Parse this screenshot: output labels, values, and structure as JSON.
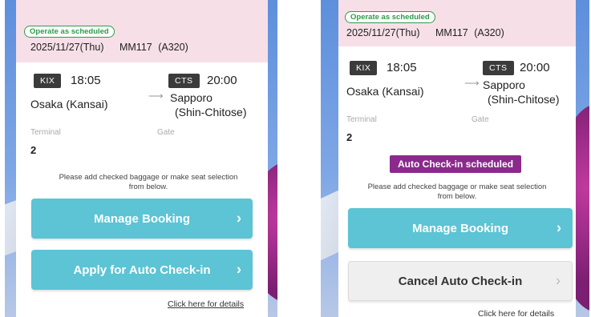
{
  "left": {
    "status": "Operate as scheduled",
    "date": "2025/11/27(Thu)",
    "flight": "MM117",
    "aircraft": "(A320)",
    "dep_code": "KIX",
    "dep_time": "18:05",
    "dep_city": "Osaka (Kansai)",
    "arr_code": "CTS",
    "arr_time": "20:00",
    "arr_city_1": "Sapporo",
    "arr_city_2": "(Shin-Chitose)",
    "terminal_label": "Terminal",
    "gate_label": "Gate",
    "terminal_value": "2",
    "note_1": "Please add checked baggage or make seat selection",
    "note_2": "from below.",
    "manage_label": "Manage Booking",
    "auto_checkin_label": "Apply for Auto Check-in",
    "details_link": "Click here for details"
  },
  "right": {
    "status": "Operate as scheduled",
    "date": "2025/11/27(Thu)",
    "flight": "MM117",
    "aircraft": "(A320)",
    "dep_code": "KIX",
    "dep_time": "18:05",
    "dep_city": "Osaka (Kansai)",
    "arr_code": "CTS",
    "arr_time": "20:00",
    "arr_city_1": "Sapporo",
    "arr_city_2": "(Shin-Chitose)",
    "terminal_label": "Terminal",
    "gate_label": "Gate",
    "terminal_value": "2",
    "auto_checkin_badge": "Auto Check-in scheduled",
    "note_1": "Please add checked baggage or make seat selection",
    "note_2": "from below.",
    "manage_label": "Manage Booking",
    "cancel_label": "Cancel Auto Check-in",
    "details_link": "Click here for details"
  },
  "icons": {
    "chevron": "chevron-right-icon",
    "arrow": "arrow-right-icon"
  },
  "colors": {
    "teal": "#5cc4d4",
    "purple": "#8b2a8c",
    "status_green": "#2e9a4a",
    "header_pink": "#f7dfe8"
  }
}
